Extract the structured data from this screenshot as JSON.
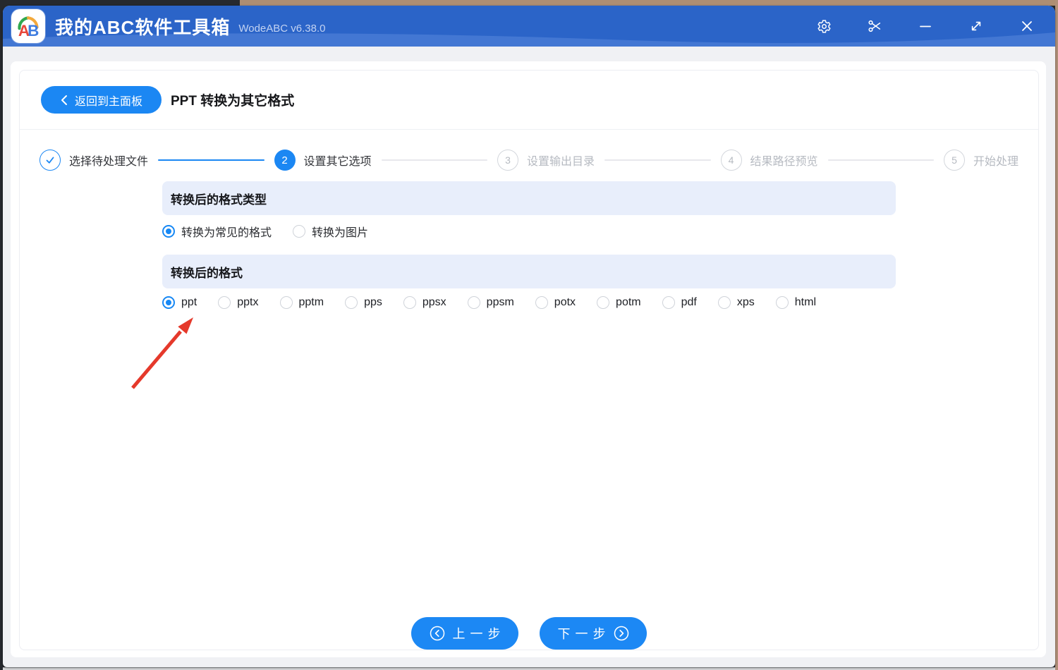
{
  "titlebar": {
    "app_title": "我的ABC软件工具箱",
    "version": "WodeABC v6.38.0",
    "logo": {
      "letter_a": "A",
      "letter_b": "B"
    },
    "action_icons": [
      "settings-gear",
      "scissors-screenshot",
      "minimize",
      "resize-expand",
      "close"
    ]
  },
  "header": {
    "back_label": "返回到主面板",
    "page_title": "PPT 转换为其它格式"
  },
  "steps": [
    {
      "num": "1",
      "label": "选择待处理文件",
      "state": "done"
    },
    {
      "num": "2",
      "label": "设置其它选项",
      "state": "active"
    },
    {
      "num": "3",
      "label": "设置输出目录",
      "state": "pending"
    },
    {
      "num": "4",
      "label": "结果路径预览",
      "state": "pending"
    },
    {
      "num": "5",
      "label": "开始处理",
      "state": "pending"
    }
  ],
  "sections": {
    "format_type": {
      "title": "转换后的格式类型",
      "options": [
        {
          "label": "转换为常见的格式",
          "selected": true
        },
        {
          "label": "转换为图片",
          "selected": false
        }
      ]
    },
    "format": {
      "title": "转换后的格式",
      "options": [
        {
          "label": "ppt",
          "selected": true
        },
        {
          "label": "pptx",
          "selected": false
        },
        {
          "label": "pptm",
          "selected": false
        },
        {
          "label": "pps",
          "selected": false
        },
        {
          "label": "ppsx",
          "selected": false
        },
        {
          "label": "ppsm",
          "selected": false
        },
        {
          "label": "potx",
          "selected": false
        },
        {
          "label": "potm",
          "selected": false
        },
        {
          "label": "pdf",
          "selected": false
        },
        {
          "label": "xps",
          "selected": false
        },
        {
          "label": "html",
          "selected": false
        }
      ]
    }
  },
  "footer": {
    "prev_label": "上一步",
    "next_label": "下一步"
  },
  "colors": {
    "accent": "#1b87f3",
    "titlebar": "#2b64c8",
    "titlebar_wave": "#4377d3",
    "section_bg": "#e8eefb",
    "arrow_red": "#e5392b"
  }
}
